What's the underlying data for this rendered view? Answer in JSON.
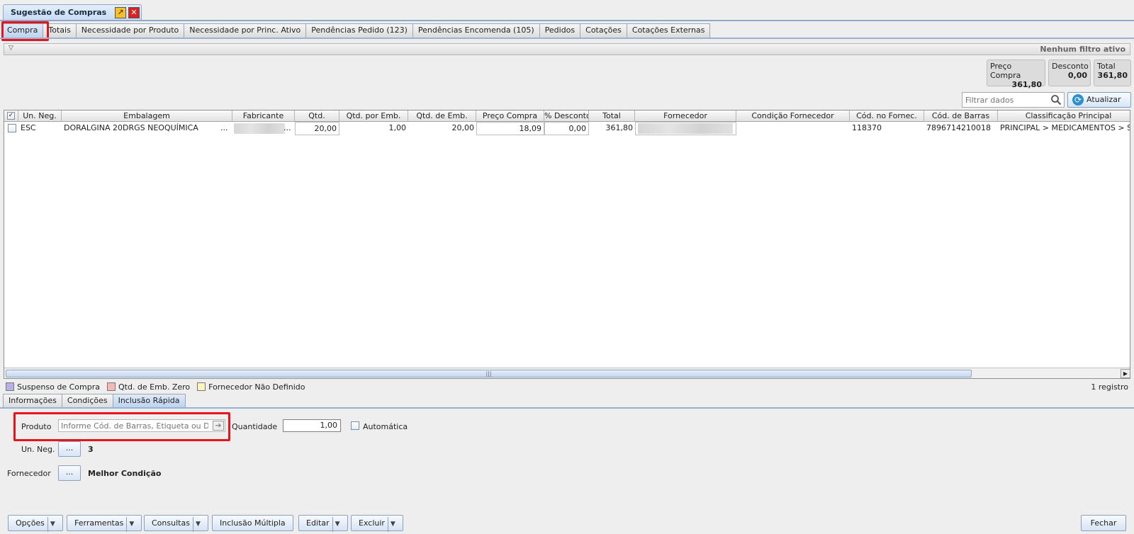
{
  "window": {
    "title": "Sugestão de Compras",
    "detach_icon": "detach-icon",
    "close_icon": "close-icon"
  },
  "tabs": [
    {
      "label": "Compra",
      "active": true
    },
    {
      "label": "Totais"
    },
    {
      "label": "Necessidade por Produto"
    },
    {
      "label": "Necessidade por Princ. Ativo"
    },
    {
      "label": "Pendências Pedido (123)"
    },
    {
      "label": "Pendências Encomenda (105)"
    },
    {
      "label": "Pedidos"
    },
    {
      "label": "Cotações"
    },
    {
      "label": "Cotações Externas"
    }
  ],
  "filter": {
    "status": "Nenhum filtro ativo",
    "toggle_icon": "triangle-down-icon"
  },
  "totals": [
    {
      "label": "Preço Compra",
      "value": "361,80"
    },
    {
      "label": "Desconto",
      "value": "0,00"
    },
    {
      "label": "Total",
      "value": "361,80"
    }
  ],
  "search": {
    "placeholder": "Filtrar dados",
    "refresh_label": "Atualizar"
  },
  "grid": {
    "columns": [
      "Un. Neg.",
      "Embalagem",
      "Fabricante",
      "Qtd.",
      "Qtd. por Emb.",
      "Qtd. de Emb.",
      "Preço Compra",
      "% Desconto",
      "Total",
      "Fornecedor",
      "Condição Fornecedor",
      "Cód. no Fornec.",
      "Cód. de Barras",
      "Classificação Principal"
    ],
    "rows": [
      {
        "un_neg": "ESC",
        "embalagem": "DORALGINA 20DRGS NEOQUÍMICA",
        "embalagem_more": "...",
        "fabricante_more": "...",
        "qtd": "20,00",
        "qtd_por_emb": "1,00",
        "qtd_de_emb": "20,00",
        "preco_compra": "18,09",
        "desconto": "0,00",
        "total": "361,80",
        "condicao": "",
        "cod_fornec": "118370",
        "cod_barras": "7896714210018",
        "classificacao": "PRINCIPAL > MEDICAMENTOS > SIM"
      }
    ]
  },
  "legend": [
    {
      "label": "Suspenso de Compra",
      "color": "#b8b0e8"
    },
    {
      "label": "Qtd. de Emb. Zero",
      "color": "#f3b8b8"
    },
    {
      "label": "Fornecedor Não Definido",
      "color": "#fbf4c0"
    }
  ],
  "record_count": "1 registro",
  "bottom_tabs": [
    {
      "label": "Informações"
    },
    {
      "label": "Condições"
    },
    {
      "label": "Inclusão Rápida",
      "active": true
    }
  ],
  "form": {
    "produto_label": "Produto",
    "produto_placeholder": "Informe Cód. de Barras, Etiqueta ou Descrição",
    "quantidade_label": "Quantidade",
    "quantidade_value": "1,00",
    "automatica_label": "Automática",
    "un_neg_label": "Un. Neg.",
    "un_neg_button": "...",
    "un_neg_value": "3",
    "fornecedor_label": "Fornecedor",
    "fornecedor_button": "...",
    "fornecedor_value": "Melhor Condição"
  },
  "footer": {
    "opcoes": "Opções",
    "ferramentas": "Ferramentas",
    "consultas": "Consultas",
    "inclusao_multipla": "Inclusão Múltipla",
    "editar": "Editar",
    "excluir": "Excluir",
    "fechar": "Fechar"
  }
}
